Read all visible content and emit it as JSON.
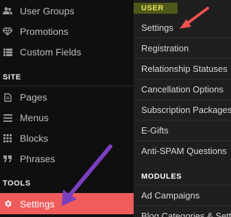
{
  "sidebar": {
    "items_top": [
      {
        "label": "User Groups",
        "icon": "users-icon"
      },
      {
        "label": "Promotions",
        "icon": "diamond-icon"
      },
      {
        "label": "Custom Fields",
        "icon": "list-icon"
      }
    ],
    "site_header": "SITE",
    "site_items": [
      {
        "label": "Pages",
        "icon": "file-icon"
      },
      {
        "label": "Menus",
        "icon": "menu-icon"
      },
      {
        "label": "Blocks",
        "icon": "grid-icon"
      },
      {
        "label": "Phrases",
        "icon": "quote-icon"
      }
    ],
    "tools_header": "TOOLS",
    "active_item": {
      "label": "Settings",
      "icon": "gear-icon"
    }
  },
  "dropdown": {
    "user_header": "USER",
    "user_items": [
      "Settings",
      "Registration",
      "Relationship Statuses",
      "Cancellation Options",
      "Subscription Packages",
      "E-Gifts",
      "Anti-SPAM Questions"
    ],
    "modules_header": "MODULES",
    "module_items": [
      "Ad Campaigns",
      "Blog Categories & Settings"
    ]
  },
  "colors": {
    "active_bg": "#f05b5b",
    "highlight_header_bg": "#4f5a1a",
    "red_arrow": "#f05050",
    "purple_arrow": "#7a3fbf"
  }
}
